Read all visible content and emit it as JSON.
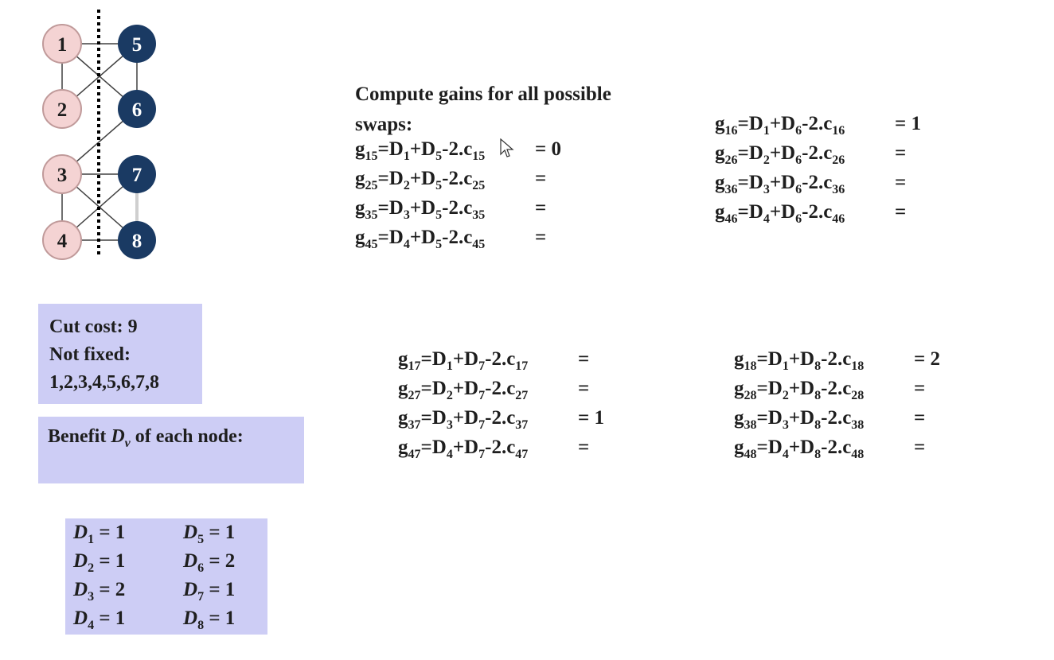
{
  "graph": {
    "left_nodes": [
      "1",
      "2",
      "3",
      "4"
    ],
    "right_nodes": [
      "5",
      "6",
      "7",
      "8"
    ],
    "colors": {
      "left_fill": "#f4d3d3",
      "left_stroke": "#c09a9a",
      "right_fill": "#1a3a63",
      "edge": "#404040"
    }
  },
  "cut_info": {
    "cut_cost": "Cut cost: 9",
    "not_fixed_label": "Not fixed:",
    "not_fixed_list": "1,2,3,4,5,6,7,8"
  },
  "benefit": {
    "label_pre": "Benefit ",
    "label_var": "D",
    "label_var_sub": "v",
    "label_post": " of each node:"
  },
  "d_values": [
    {
      "name": "D",
      "sub": "1",
      "value": "= 1"
    },
    {
      "name": "D",
      "sub": "2",
      "value": "= 1"
    },
    {
      "name": "D",
      "sub": "3",
      "value": "= 2"
    },
    {
      "name": "D",
      "sub": "4",
      "value": "= 1"
    },
    {
      "name": "D",
      "sub": "5",
      "value": "= 1"
    },
    {
      "name": "D",
      "sub": "6",
      "value": "= 2"
    },
    {
      "name": "D",
      "sub": "7",
      "value": "= 1"
    },
    {
      "name": "D",
      "sub": "8",
      "value": "= 1"
    }
  ],
  "heading": {
    "line1": "Compute gains for all possible",
    "line2": "swaps:"
  },
  "gains": [
    {
      "a": "1",
      "b": "5",
      "result": "= 0"
    },
    {
      "a": "2",
      "b": "5",
      "result": "="
    },
    {
      "a": "3",
      "b": "5",
      "result": "="
    },
    {
      "a": "4",
      "b": "5",
      "result": "="
    },
    {
      "a": "1",
      "b": "6",
      "result": "= 1"
    },
    {
      "a": "2",
      "b": "6",
      "result": "="
    },
    {
      "a": "3",
      "b": "6",
      "result": "="
    },
    {
      "a": "4",
      "b": "6",
      "result": "="
    },
    {
      "a": "1",
      "b": "7",
      "result": "="
    },
    {
      "a": "2",
      "b": "7",
      "result": "="
    },
    {
      "a": "3",
      "b": "7",
      "result": "= 1"
    },
    {
      "a": "4",
      "b": "7",
      "result": "="
    },
    {
      "a": "1",
      "b": "8",
      "result": "= 2"
    },
    {
      "a": "2",
      "b": "8",
      "result": "="
    },
    {
      "a": "3",
      "b": "8",
      "result": "="
    },
    {
      "a": "4",
      "b": "8",
      "result": "="
    }
  ]
}
